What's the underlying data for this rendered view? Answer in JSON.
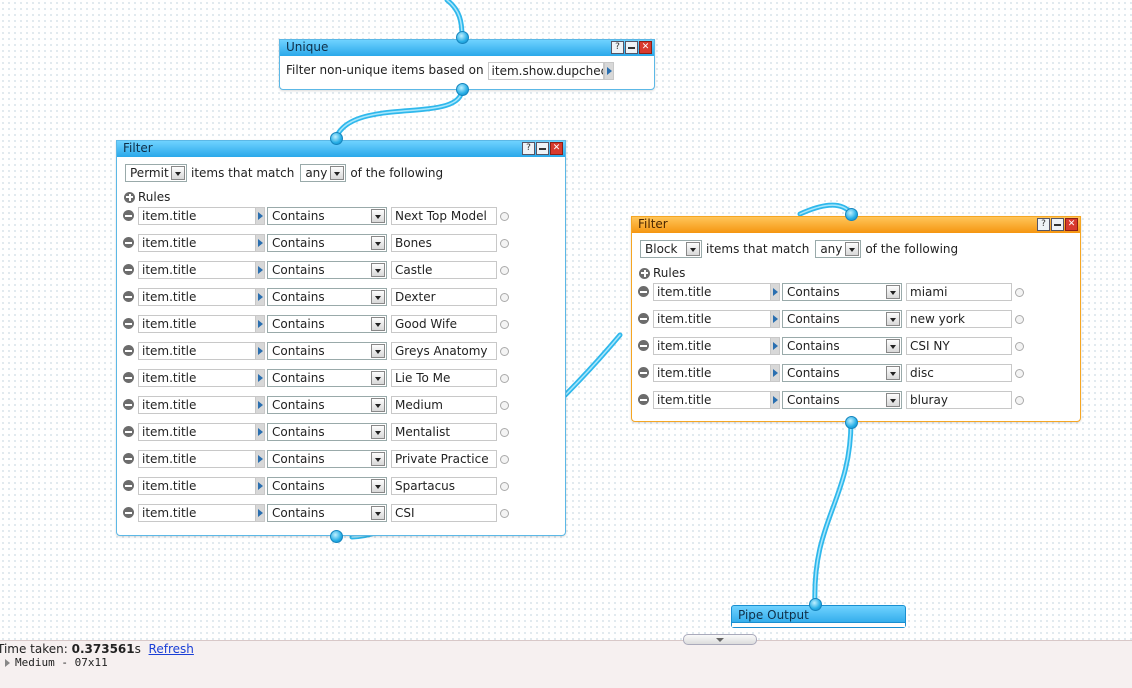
{
  "unique_module": {
    "title": "Unique",
    "prompt": "Filter non-unique items based on",
    "field_value": "item.show.dupcheck"
  },
  "filter_left": {
    "title": "Filter",
    "mode": "Permit",
    "match_prefix": "items that match",
    "match": "any",
    "match_suffix": "of the following",
    "rules_label": "Rules",
    "rules": [
      {
        "field": "item.title",
        "op": "Contains",
        "value": "Next Top Model"
      },
      {
        "field": "item.title",
        "op": "Contains",
        "value": "Bones"
      },
      {
        "field": "item.title",
        "op": "Contains",
        "value": "Castle"
      },
      {
        "field": "item.title",
        "op": "Contains",
        "value": "Dexter"
      },
      {
        "field": "item.title",
        "op": "Contains",
        "value": "Good Wife"
      },
      {
        "field": "item.title",
        "op": "Contains",
        "value": "Greys Anatomy"
      },
      {
        "field": "item.title",
        "op": "Contains",
        "value": "Lie To Me"
      },
      {
        "field": "item.title",
        "op": "Contains",
        "value": "Medium"
      },
      {
        "field": "item.title",
        "op": "Contains",
        "value": "Mentalist"
      },
      {
        "field": "item.title",
        "op": "Contains",
        "value": "Private Practice"
      },
      {
        "field": "item.title",
        "op": "Contains",
        "value": "Spartacus"
      },
      {
        "field": "item.title",
        "op": "Contains",
        "value": "CSI"
      }
    ]
  },
  "filter_right": {
    "title": "Filter",
    "mode": "Block",
    "match_prefix": "items that match",
    "match": "any",
    "match_suffix": "of the following",
    "rules_label": "Rules",
    "rules": [
      {
        "field": "item.title",
        "op": "Contains",
        "value": "miami"
      },
      {
        "field": "item.title",
        "op": "Contains",
        "value": "new york"
      },
      {
        "field": "item.title",
        "op": "Contains",
        "value": "CSI NY"
      },
      {
        "field": "item.title",
        "op": "Contains",
        "value": "disc"
      },
      {
        "field": "item.title",
        "op": "Contains",
        "value": "bluray"
      }
    ]
  },
  "pipe_output": {
    "title": "Pipe Output"
  },
  "debug": {
    "time_label": "Time taken:",
    "time_value": "0.373561",
    "time_unit": "s",
    "refresh": "Refresh",
    "item_line": "Medium - 07x11"
  },
  "header_buttons": {
    "help": "?"
  },
  "colors": {
    "wire": "#3ec3ef",
    "blue_header": "#2aa8ea",
    "orange_header": "#f59510"
  }
}
